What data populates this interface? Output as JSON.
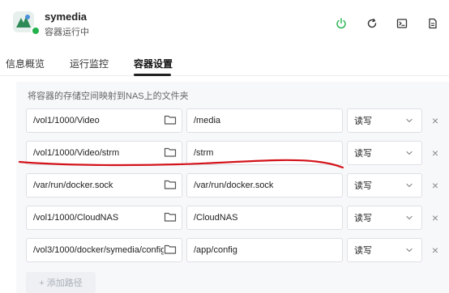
{
  "header": {
    "app_name": "symedia",
    "app_status": "容器运行中",
    "colors": {
      "running": "#22b24c",
      "power": "#22b24c",
      "icon": "#333333"
    },
    "buttons": [
      {
        "icon": "power-icon"
      },
      {
        "icon": "refresh-icon"
      },
      {
        "icon": "terminal-icon"
      },
      {
        "icon": "log-icon"
      }
    ]
  },
  "tabs": [
    {
      "label": "信息概览",
      "active": false
    },
    {
      "label": "运行监控",
      "active": false
    },
    {
      "label": "容器设置",
      "active": true
    }
  ],
  "volumes": {
    "description": "将容器的存储空间映射到NAS上的文件夹",
    "rows": [
      {
        "host_path": "/vol1/1000/Video",
        "container_path": "/media",
        "mode": "读写"
      },
      {
        "host_path": "/vol1/1000/Video/strm",
        "container_path": "/strm",
        "mode": "读写"
      },
      {
        "host_path": "/var/run/docker.sock",
        "container_path": "/var/run/docker.sock",
        "mode": "读写"
      },
      {
        "host_path": "/vol1/1000/CloudNAS",
        "container_path": "/CloudNAS",
        "mode": "读写"
      },
      {
        "host_path": "/vol3/1000/docker/symedia/config",
        "container_path": "/app/config",
        "mode": "读写"
      }
    ],
    "remove_symbol": "×",
    "add_label": "+ 添加路径"
  },
  "annotation_color": "#d3131b"
}
